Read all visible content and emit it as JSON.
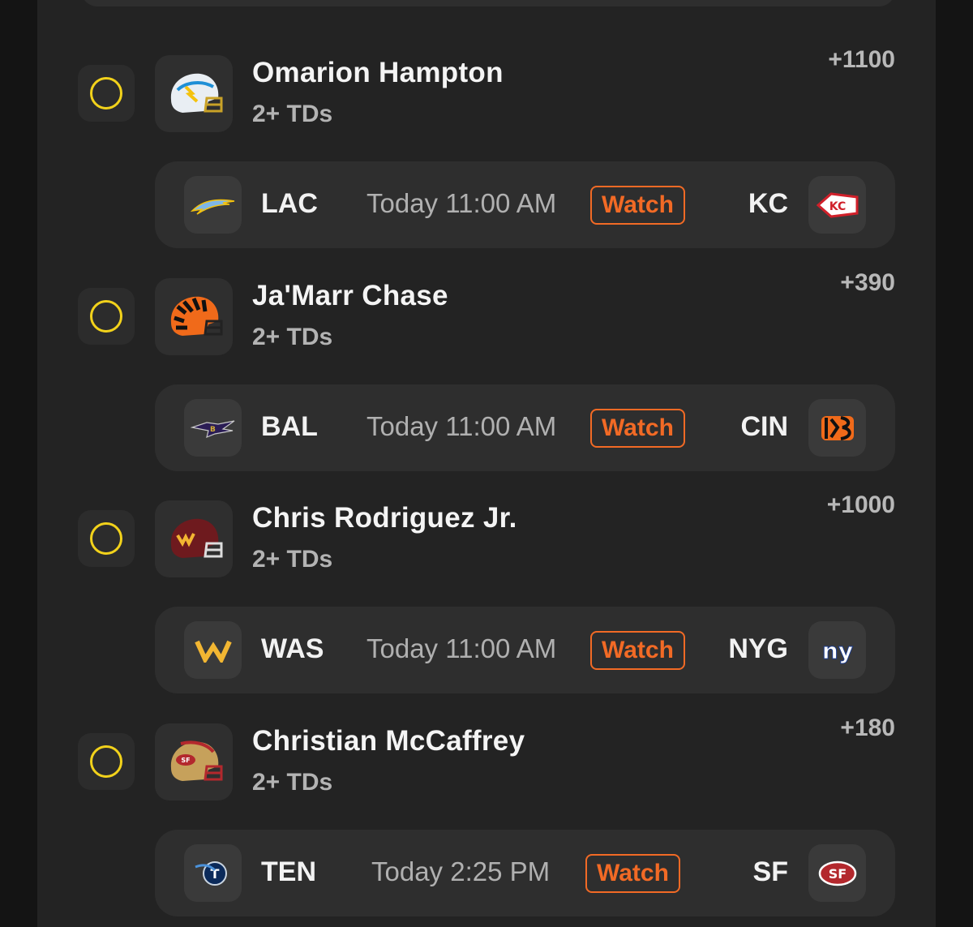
{
  "picks": [
    {
      "player": "Omarion Hampton",
      "market": "2+ TDs",
      "odds": "+1100",
      "helmet_icon": "chargers-helmet-icon",
      "game": {
        "away": "LAC",
        "away_icon": "chargers-bolt-icon",
        "time": "Today 11:00 AM",
        "watch": "Watch",
        "home": "KC",
        "home_icon": "chiefs-arrowhead-icon"
      }
    },
    {
      "player": "Ja'Marr Chase",
      "market": "2+ TDs",
      "odds": "+390",
      "helmet_icon": "bengals-helmet-icon",
      "game": {
        "away": "BAL",
        "away_icon": "ravens-icon",
        "time": "Today 11:00 AM",
        "watch": "Watch",
        "home": "CIN",
        "home_icon": "bengals-b-icon"
      }
    },
    {
      "player": "Chris Rodriguez Jr.",
      "market": "2+ TDs",
      "odds": "+1000",
      "helmet_icon": "commanders-helmet-icon",
      "game": {
        "away": "WAS",
        "away_icon": "commanders-w-icon",
        "time": "Today 11:00 AM",
        "watch": "Watch",
        "home": "NYG",
        "home_icon": "giants-ny-icon"
      }
    },
    {
      "player": "Christian McCaffrey",
      "market": "2+ TDs",
      "odds": "+180",
      "helmet_icon": "49ers-helmet-icon",
      "game": {
        "away": "TEN",
        "away_icon": "titans-icon",
        "time": "Today 2:25 PM",
        "watch": "Watch",
        "home": "SF",
        "home_icon": "49ers-sf-icon"
      }
    }
  ],
  "colors": {
    "accent_orange": "#f26a25",
    "radio_yellow": "#f2d21b",
    "panel_bg": "#232323"
  }
}
